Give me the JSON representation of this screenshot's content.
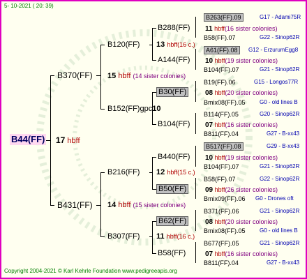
{
  "header": {
    "date": "5- 10-2021 ( 20: 39)"
  },
  "footer": {
    "copyright": "Copyright 2004-2021 © Karl Kehrle Foundation    www.pedigreeapis.org"
  },
  "root": {
    "label": "B44(FF)",
    "gen_num": "17",
    "gen_txt": "hbff"
  },
  "gen1": [
    {
      "label": "B370(FF)",
      "gen_num": "15",
      "gen_txt": "hbff",
      "sis": "(14 sister colonies)"
    },
    {
      "label": "B431(FF)",
      "gen_num": "14",
      "gen_txt": "hbff",
      "sis": "(15 sister colonies)"
    }
  ],
  "gen2": [
    {
      "label": "B120(FF)",
      "gen_num": "13",
      "gen_txt": "hbff",
      "sis": "(16 c.)"
    },
    {
      "label": "B152(FF)gpc",
      "gen_num": "10",
      "gen_txt": "",
      "sis": ""
    },
    {
      "label": "B216(FF)",
      "gen_num": "12",
      "gen_txt": "hbff",
      "sis": "(15 c.)"
    },
    {
      "label": "B307(FF)",
      "gen_num": "11",
      "gen_txt": "hbff",
      "sis": "(16 c.)"
    }
  ],
  "gen3": [
    {
      "label": "B288(FF)",
      "gen_num": "11",
      "gen_txt": "hbff",
      "sis": "(16 sister colonies)"
    },
    {
      "label": "A144(FF)",
      "gen_num": "10",
      "gen_txt": "hbff",
      "sis": "(19 sister colonies)"
    },
    {
      "label": "B30(FF)",
      "gen_num": "08",
      "gen_txt": "hbff",
      "sis": "(20 sister colonies)"
    },
    {
      "label": "B104(FF)",
      "gen_num": "07",
      "gen_txt": "hbff",
      "sis": "(16 sister colonies)"
    },
    {
      "label": "B440(FF)",
      "gen_num": "10",
      "gen_txt": "hbff",
      "sis": "(19 sister colonies)"
    },
    {
      "label": "B50(FF)",
      "gen_num": "09",
      "gen_txt": "hbff",
      "sis": "(26 sister colonies)"
    },
    {
      "label": "B62(FF)",
      "gen_num": "08",
      "gen_txt": "hbff",
      "sis": "(20 sister colonies)"
    },
    {
      "label": "B58(FF)",
      "gen_num": "07",
      "gen_txt": "hbff",
      "sis": "(16 sister colonies)"
    }
  ],
  "gen4": [
    {
      "label": "B263(FF).09",
      "note": "G17 - Adami75R"
    },
    {
      "label": "B58(FF).07",
      "note": "G22 - Sinop62R"
    },
    {
      "label": "A61(FF).08",
      "note": "G12 - ErzurumEgg8"
    },
    {
      "label": "B104(FF).07",
      "note": "G21 - Sinop62R"
    },
    {
      "label": "B19(FF).06",
      "note": "G15 - Longos77R"
    },
    {
      "label": "Bmix08(FF).05",
      "note": "G0 - old lines B"
    },
    {
      "label": "B114(FF).05",
      "note": "G20 - Sinop62R"
    },
    {
      "label": "B811(FF).04",
      "note": "G27 - B-xx43"
    },
    {
      "label": "B517(FF).08",
      "note": "G29 - B-xx43"
    },
    {
      "label": "B104(FF).07",
      "note": "G21 - Sinop62R"
    },
    {
      "label": "B58(FF).07",
      "note": "G22 - Sinop62R"
    },
    {
      "label": "Bmix09(FF).06",
      "note": "G0 - Drones oft"
    },
    {
      "label": "B371(FF).06",
      "note": "G21 - Sinop62R"
    },
    {
      "label": "Bmix08(FF).05",
      "note": "G0 - old lines B"
    },
    {
      "label": "B677(FF).05",
      "note": "G21 - Sinop62R"
    },
    {
      "label": "B811(FF).04",
      "note": "G27 - B-xx43"
    }
  ]
}
